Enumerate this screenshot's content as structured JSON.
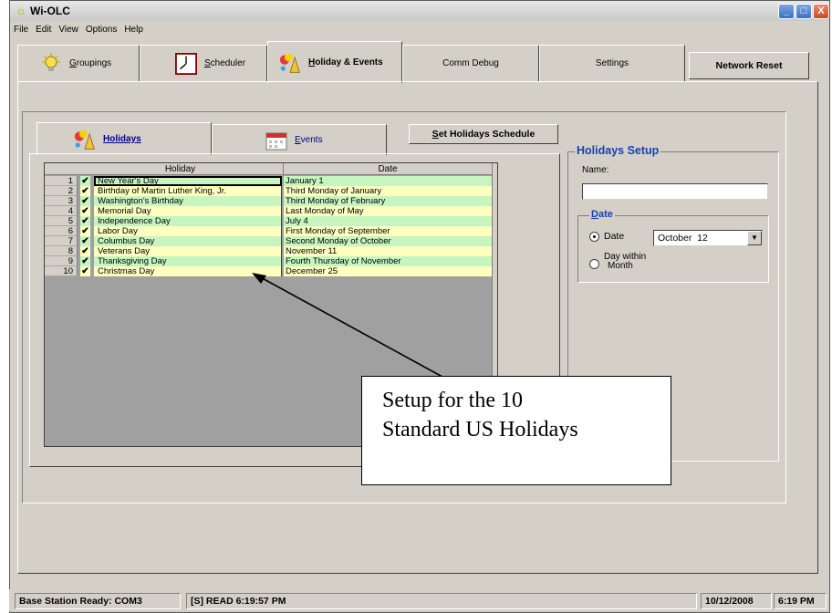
{
  "window": {
    "title": "Wi-OLC",
    "min": "_",
    "max": "□",
    "close": "X"
  },
  "menu": [
    "File",
    "Edit",
    "View",
    "Options",
    "Help"
  ],
  "tabs": [
    {
      "label": "Groupings",
      "accent": "G",
      "rest": "roupings"
    },
    {
      "label": "Scheduler",
      "accent": "S",
      "rest": "cheduler"
    },
    {
      "label": "Holiday & Events",
      "accent": "H",
      "rest": "oliday & Events"
    },
    {
      "label": "Comm Debug"
    },
    {
      "label": "Settings"
    },
    {
      "label": "Network Reset"
    }
  ],
  "subtabs": {
    "holidays": {
      "accent": "H",
      "rest": "olidays"
    },
    "events": {
      "accent": "E",
      "rest": "vents"
    }
  },
  "set_button": {
    "accent": "S",
    "rest": "et Holidays Schedule"
  },
  "grid": {
    "headers": [
      "Holiday",
      "Date"
    ],
    "rows": [
      {
        "num": "1",
        "checked": "✔",
        "holiday": "New Year's Day",
        "date": "January 1"
      },
      {
        "num": "2",
        "checked": "✔",
        "holiday": "Birthday of Martin Luther King, Jr.",
        "date": "Third Monday of January"
      },
      {
        "num": "3",
        "checked": "✔",
        "holiday": "Washington's Birthday",
        "date": "Third Monday of February"
      },
      {
        "num": "4",
        "checked": "✔",
        "holiday": "Memorial Day",
        "date": "Last Monday of May"
      },
      {
        "num": "5",
        "checked": "✔",
        "holiday": "Independence Day",
        "date": "July 4"
      },
      {
        "num": "6",
        "checked": "✔",
        "holiday": "Labor Day",
        "date": "First Monday of September"
      },
      {
        "num": "7",
        "checked": "✔",
        "holiday": "Columbus Day",
        "date": "Second Monday of October"
      },
      {
        "num": "8",
        "checked": "✔",
        "holiday": "Veterans Day",
        "date": "November 11"
      },
      {
        "num": "9",
        "checked": "✔",
        "holiday": "Thanksgiving Day",
        "date": "Fourth Thursday of November"
      },
      {
        "num": "10",
        "checked": "✔",
        "holiday": "Christmas Day",
        "date": "December 25"
      }
    ]
  },
  "setup": {
    "title": "Holidays Setup",
    "name_label": "Name:",
    "name_value": "",
    "date_group": {
      "accent": "D",
      "rest": "ate"
    },
    "radio_date": "Date",
    "radio_day_line1": "Day within",
    "radio_day_line2": "Month",
    "date_value": "October  12"
  },
  "callout": {
    "line1": "Setup for the 10",
    "line2": "Standard US Holidays"
  },
  "status": {
    "base": "Base Station Ready: COM3",
    "read": "[S] READ  6:19:57 PM",
    "date": "10/12/2008",
    "time": "6:19 PM"
  },
  "colors": {
    "row_green": "#c6f5c0",
    "row_yellow": "#ffffc0",
    "accent_blue": "#1a3fb0"
  }
}
